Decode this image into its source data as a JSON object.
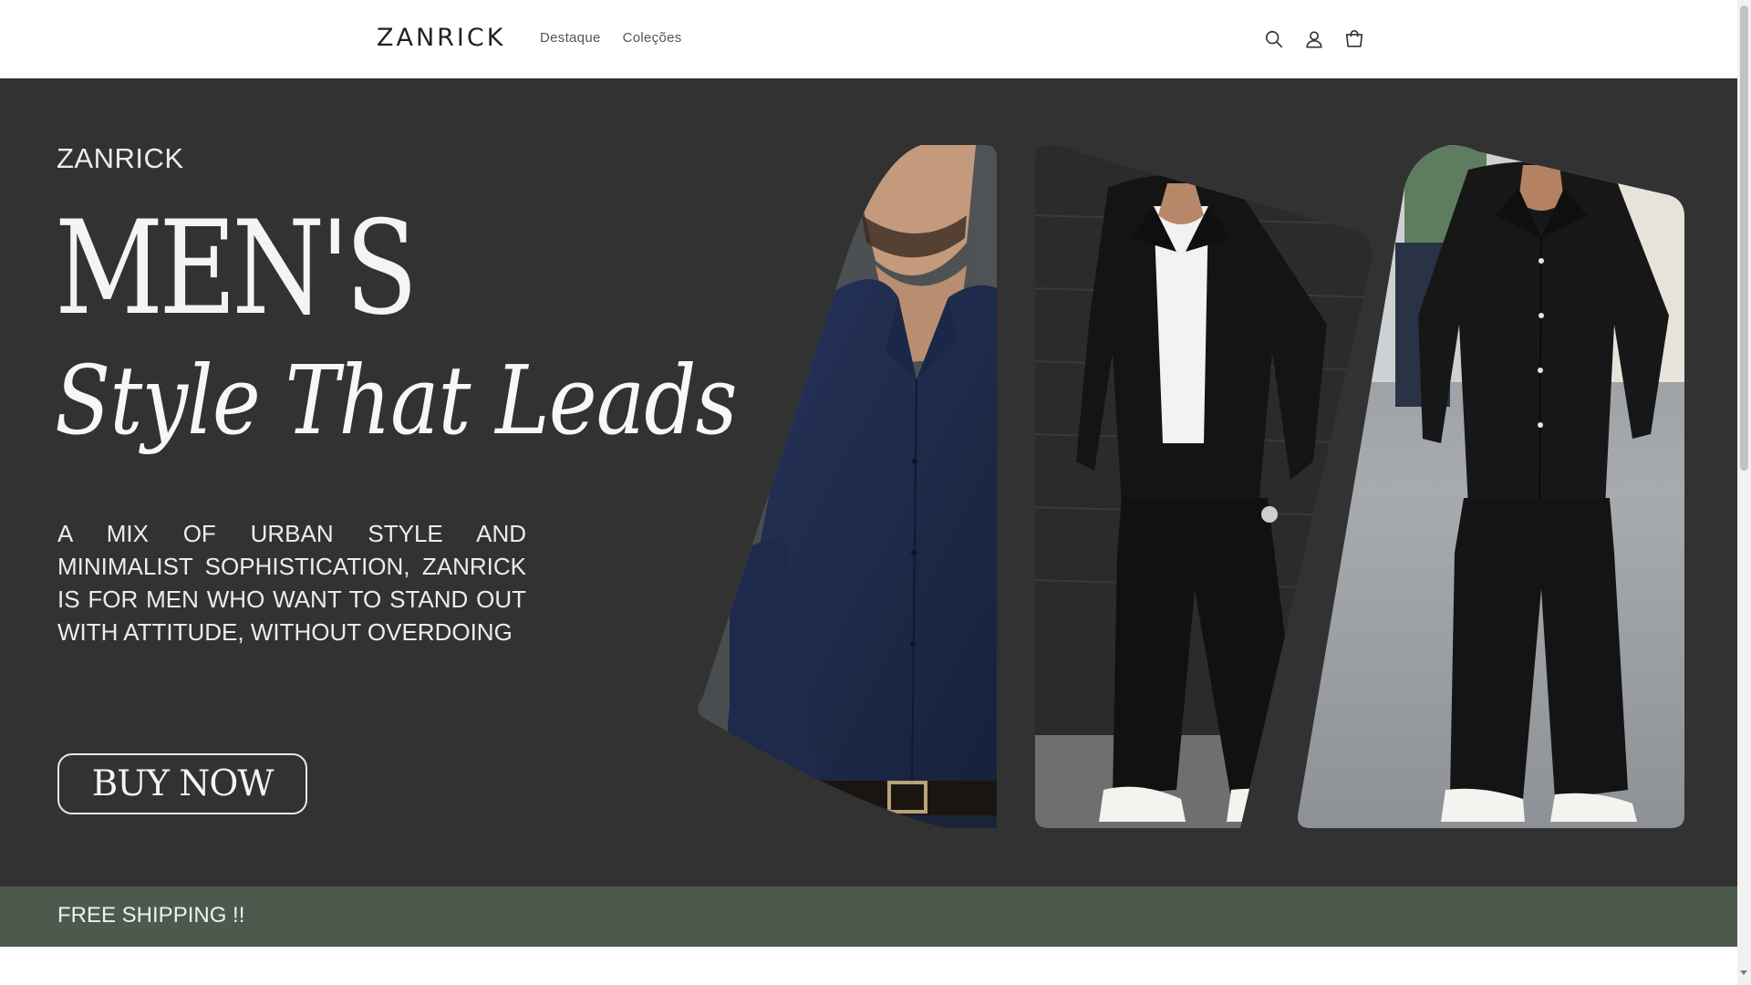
{
  "header": {
    "logo": "ZANRICK",
    "nav": [
      {
        "label": "Destaque"
      },
      {
        "label": "Coleções"
      }
    ],
    "icons": [
      "search-icon",
      "account-icon",
      "cart-icon"
    ]
  },
  "hero": {
    "brand": "ZANRICK",
    "title": "MEN'S",
    "script": "Style That Leads",
    "description": "A MIX OF URBAN STYLE AND MINIMALIST SOPHISTICATION, ZANRICK IS FOR MEN WHO WANT TO STAND OUT WITH ATTITUDE, WITHOUT OVERDOING",
    "button_label": "BUY NOW",
    "photos": [
      "model-navy-shirt",
      "model-black-set-white-tee",
      "model-black-set-full"
    ]
  },
  "banner": {
    "shipping": "FREE SHIPPING !!"
  },
  "colors": {
    "hero_bg": "#323232",
    "banner_bg": "#4b5a4c",
    "navy_shirt": "#1f2b4a",
    "black_outfit": "#141414"
  }
}
